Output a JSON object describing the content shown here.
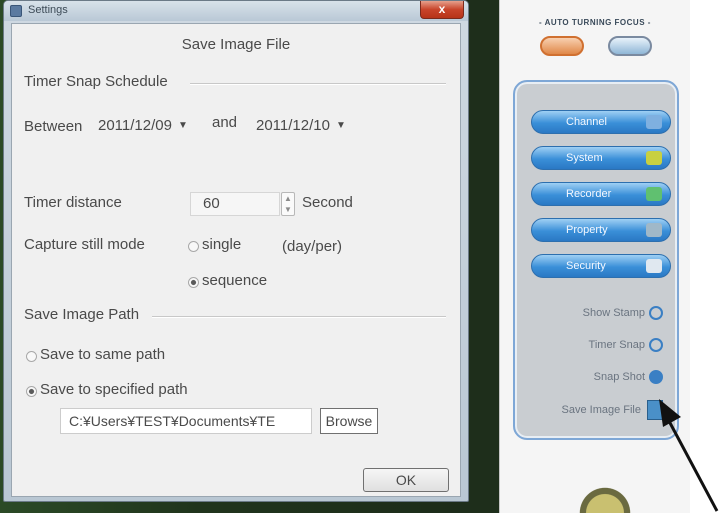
{
  "window": {
    "title": "Settings",
    "close_symbol": "x",
    "heading": "Save Image File"
  },
  "timer_schedule": {
    "section_label": "Timer Snap Schedule",
    "between_label": "Between",
    "start_date": "2011/12/09",
    "and_label": "and",
    "end_date": "2011/12/10",
    "distance_label": "Timer distance",
    "distance_value": "60",
    "distance_unit": "Second",
    "capture_mode_label": "Capture still mode",
    "mode_single": "single",
    "mode_single_hint": "(day/per)",
    "mode_sequence": "sequence",
    "selected_mode": "sequence"
  },
  "save_path": {
    "section_label": "Save Image Path",
    "option_same": "Save to same path",
    "option_specified": "Save to specified path",
    "selected_option": "specified",
    "path_value": "C:¥Users¥TEST¥Documents¥TE",
    "browse_label": "Browse"
  },
  "ok_label": "OK",
  "panel": {
    "auto_label": "- AUTO TURNING FOCUS -",
    "menu_buttons": [
      {
        "label": "Channel",
        "icon": "channel-icon",
        "color": "#3a8fd8"
      },
      {
        "label": "System",
        "icon": "system-icon",
        "color": "#3a8fd8"
      },
      {
        "label": "Recorder",
        "icon": "recorder-icon",
        "color": "#3a8fd8"
      },
      {
        "label": "Property",
        "icon": "property-icon",
        "color": "#3a8fd8"
      },
      {
        "label": "Security",
        "icon": "security-icon",
        "color": "#3a8fd8"
      }
    ],
    "side_items": [
      {
        "label": "Show Stamp",
        "icon": "clock-icon"
      },
      {
        "label": "Timer Snap",
        "icon": "timer-icon"
      },
      {
        "label": "Snap Shot",
        "icon": "camera-icon"
      },
      {
        "label": "Save Image File",
        "icon": "save-file-icon"
      }
    ]
  }
}
